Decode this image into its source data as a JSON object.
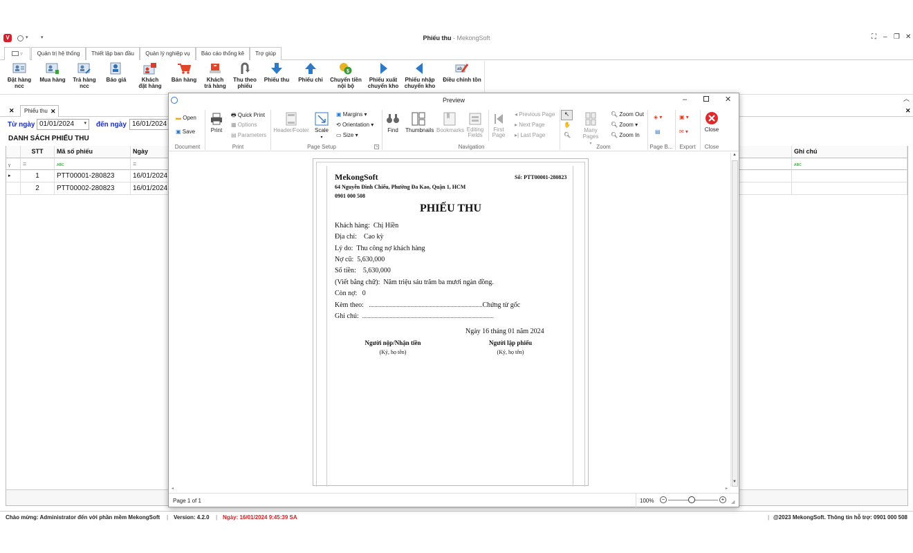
{
  "app": {
    "title": "Phiếu thu",
    "title_suffix": " - MekongSoft"
  },
  "main_tabs": [
    "Quản trị hệ thống",
    "Thiết lập ban đầu",
    "Quản lý nghiệp vụ",
    "Báo cáo thống kê",
    "Trợ giúp"
  ],
  "ribbon": [
    {
      "l1": "Đặt hàng",
      "l2": "ncc",
      "icon": "order-supplier-icon"
    },
    {
      "l1": "Mua hàng",
      "l2": "",
      "icon": "purchase-icon"
    },
    {
      "l1": "Trả hàng",
      "l2": "ncc",
      "icon": "return-supplier-icon"
    },
    {
      "l1": "Báo giá",
      "l2": "",
      "icon": "quote-icon"
    },
    {
      "l1": "Khách",
      "l2": "đặt hàng",
      "icon": "customer-order-icon"
    },
    {
      "l1": "Bán hàng",
      "l2": "",
      "icon": "cart-icon"
    },
    {
      "l1": "Khách",
      "l2": "trả hàng",
      "icon": "customer-return-icon"
    },
    {
      "l1": "Thu theo",
      "l2": "phiếu",
      "icon": "collect-icon"
    },
    {
      "l1": "Phiếu thu",
      "l2": "",
      "icon": "arrow-down-icon"
    },
    {
      "l1": "Phiếu chi",
      "l2": "",
      "icon": "arrow-up-icon"
    },
    {
      "l1": "Chuyển tiền",
      "l2": "nội bộ",
      "icon": "money-transfer-icon"
    },
    {
      "l1": "Phiếu xuất",
      "l2": "chuyển kho",
      "icon": "arrow-right-icon"
    },
    {
      "l1": "Phiếu nhập",
      "l2": "chuyển kho",
      "icon": "arrow-left-icon"
    },
    {
      "l1": "Điều chỉnh tồn",
      "l2": "",
      "icon": "adjust-stock-icon"
    }
  ],
  "doc_tab": "Phiếu thu",
  "filter": {
    "from_label": "Từ ngày",
    "from_value": "01/01/2024",
    "to_label": "đến ngày",
    "to_value": "16/01/2024"
  },
  "list_title": "DANH SÁCH PHIẾU THU",
  "grid": {
    "headers": {
      "stt": "STT",
      "code": "Mã số phiếu",
      "date": "Ngày",
      "note": "Ghi chú"
    },
    "filter_eq": "=",
    "rows": [
      {
        "stt": "1",
        "code": "PTT00001-280823",
        "date": "16/01/2024"
      },
      {
        "stt": "2",
        "code": "PTT00002-280823",
        "date": "16/01/2024"
      }
    ]
  },
  "status": {
    "welcome": "Chào mừng: Administrator đến với phần mềm MekongSoft",
    "version": "Version: 4.2.0",
    "date": "Ngày: 16/01/2024 9:45:39 SA",
    "copyright": "@2023 MekongSoft. Thông tin hỗ trợ: 0901 000 508"
  },
  "preview": {
    "title": "Preview",
    "tools": {
      "open": "Open",
      "save": "Save",
      "print": "Print",
      "quick_print": "Quick Print",
      "options": "Options",
      "parameters": "Parameters",
      "header_footer": "Header/Footer",
      "scale": "Scale",
      "margins": "Margins",
      "orientation": "Orientation",
      "size": "Size",
      "find": "Find",
      "thumbnails": "Thumbnails",
      "bookmarks": "Bookmarks",
      "editing1": "Editing",
      "editing2": "Fields",
      "first1": "First",
      "first2": "Page",
      "prev_page": "Previous Page",
      "next_page": "Next Page",
      "last_page": "Last Page",
      "many_pages": "Many Pages",
      "zoom_out": "Zoom Out",
      "zoom": "Zoom",
      "zoom_in": "Zoom In",
      "close": "Close"
    },
    "groups": {
      "document": "Document",
      "print": "Print",
      "page_setup": "Page Setup",
      "navigation": "Navigation",
      "zoom": "Zoom",
      "page_b": "Page B...",
      "export": "Export",
      "close": "Close"
    },
    "page_status": "Page 1 of 1",
    "zoom_level": "100%",
    "receipt": {
      "company": "MekongSoft",
      "number": "Số: PTT00001-280823",
      "address": "64 Nguyễn Đình Chiểu, Phường Đa Kao, Quận 1, HCM",
      "phone": "0901 000 508",
      "heading": "PHIẾU THU",
      "customer_label": "Khách hàng:",
      "customer": "Chị Hiền",
      "address_label": "Địa chỉ:",
      "address_value": "Cao kỳ",
      "reason_label": "Lý do:",
      "reason": "Thu công nợ khách hàng",
      "old_debt_label": "Nợ cũ:",
      "old_debt": "5,630,000",
      "amount_label": "Số tiền:",
      "amount": "5,630,000",
      "in_words_label": "(Viết bằng chữ):",
      "in_words": "Năm triệu sáu trăm ba mươi ngàn đồng.",
      "remaining_label": "Còn nợ:",
      "remaining": "0",
      "attached_label": "Kèm theo:",
      "attached_dots": "..................................................................................",
      "attached_suffix": "Chứng từ gốc",
      "note_label": "Ghi chú:",
      "note_dots": "...............................................................................................",
      "date_line": "Ngày 16 tháng 01 năm 2024",
      "payer": "Người nộp/Nhận tiền",
      "payer_sign": "(Ký, họ tên)",
      "maker": "Người lập phiếu",
      "maker_sign": "(Ký, họ tên)"
    }
  }
}
